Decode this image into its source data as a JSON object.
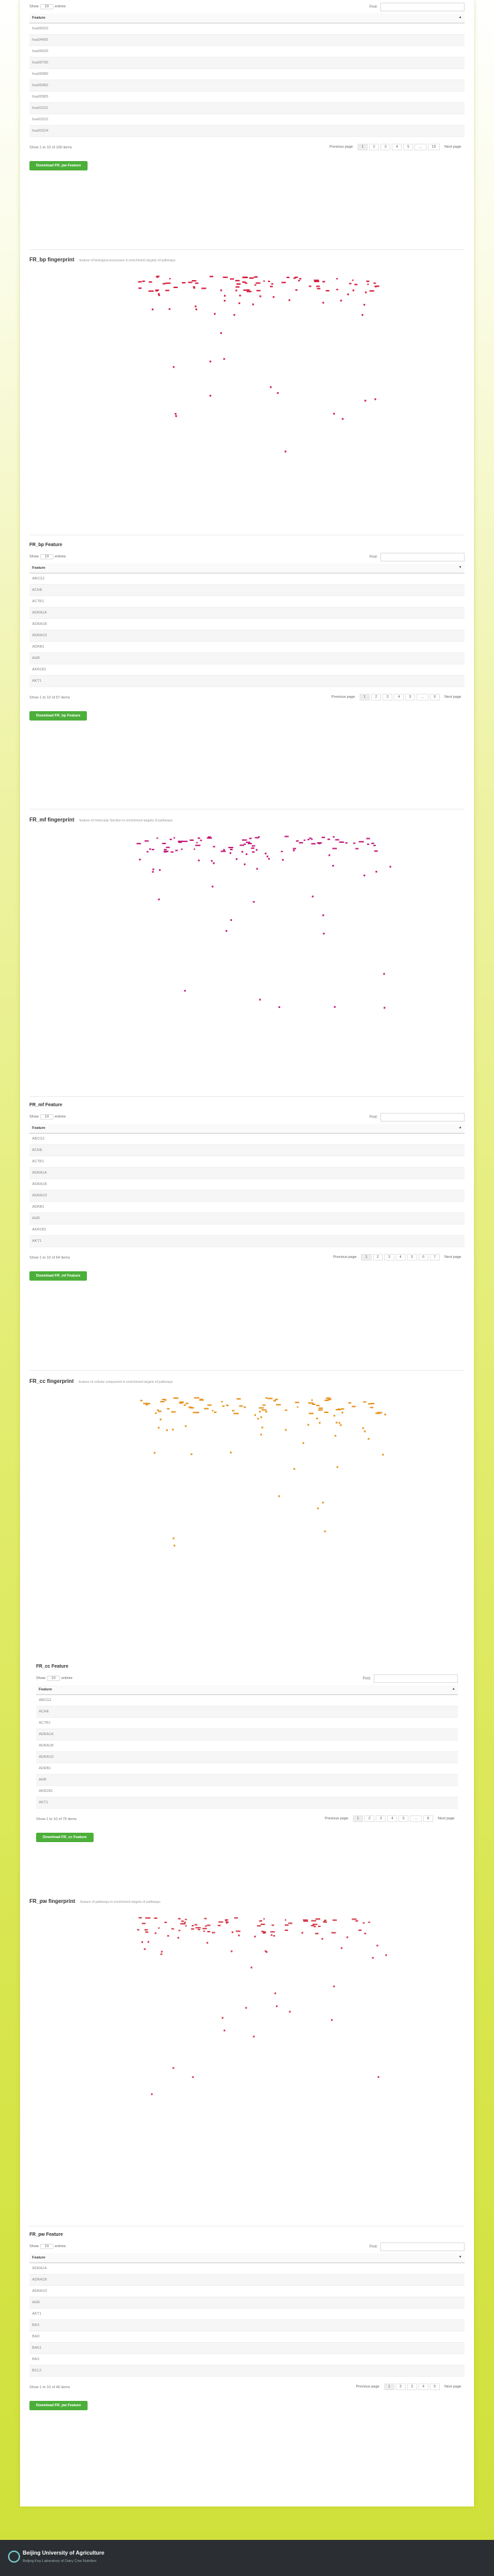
{
  "common": {
    "show_label": "Show",
    "entries_label": "entries",
    "page_size": "10",
    "find_label": "Find:",
    "feature_header": "Feature",
    "prev": "Previous page",
    "next": "Next page",
    "ellipsis": "…"
  },
  "tables": [
    {
      "title": "",
      "rows": [
        "hsa00910",
        "hsa04666",
        "hsa00020",
        "hsa00790",
        "hsa00980",
        "hsa00982",
        "hsa00983",
        "hsa01521",
        "hsa01522",
        "hsa01524"
      ],
      "info": "Show 1 to 10 of 190 items",
      "pages": [
        "1",
        "2",
        "3",
        "4",
        "5",
        "…",
        "19"
      ],
      "download": "Download FR_pw Feature"
    },
    {
      "title": "FR_bp Feature",
      "rows": [
        "ABCG2",
        "ACHE",
        "ACTB1",
        "ADRA1A",
        "ADRA1B",
        "ADRA1D",
        "ADRB1",
        "AHR",
        "AKR1B1",
        "AKT1"
      ],
      "info": "Show 1 to 10 of 57 items",
      "pages": [
        "1",
        "2",
        "3",
        "4",
        "5",
        "…",
        "6"
      ],
      "download": "Download FR_bp Feature"
    },
    {
      "title": "FR_mf Feature",
      "rows": [
        "ABCG2",
        "ACHE",
        "ACTB1",
        "ADRA1A",
        "ADRA1B",
        "ADRA1D",
        "ADRB1",
        "AHR",
        "AKR1B1",
        "AKT1"
      ],
      "info": "Show 1 to 10 of 64 items",
      "pages": [
        "1",
        "2",
        "3",
        "4",
        "5",
        "6",
        "7"
      ],
      "download": "Download FR_mf Feature"
    },
    {
      "title": "FR_cc Feature",
      "rows": [
        "ABCG2",
        "ACHE",
        "ACTB1",
        "ADRA1A",
        "ADRA1B",
        "ADRA1D",
        "ADRB1",
        "AHR",
        "AKR1B1",
        "AKT1"
      ],
      "info": "Show 1 to 10 of 75 items",
      "pages": [
        "1",
        "2",
        "3",
        "4",
        "5",
        "…",
        "8"
      ],
      "download": "Download FR_cc Feature"
    },
    {
      "title": "FR_pw Feature",
      "rows": [
        "ADRA1A",
        "ADRA1B",
        "ADRA1D",
        "AHR",
        "AKT1",
        "BAX",
        "BAD",
        "BAK1",
        "BAX",
        "BCL2"
      ],
      "info": "Show 1 to 10 of 46 items",
      "pages": [
        "1",
        "2",
        "3",
        "4",
        "5"
      ],
      "download": "Download FR_pw Feature"
    }
  ],
  "plots": [
    {
      "title": "FR_bp fingerprint",
      "subtitle": "feature of biological processes in enrichment targets of pathways",
      "color": "#d6183a"
    },
    {
      "title": "FR_mf fingerprint",
      "subtitle": "feature of molecular function in enrichment targets of pathways",
      "color": "#c2187a"
    },
    {
      "title": "FR_cc fingerprint",
      "subtitle": "feature of cellular component in enrichment targets of pathways",
      "color": "#e8901a"
    },
    {
      "title": "FR_pw fingerprint",
      "subtitle": "feature of pathways in enrichment targets of pathways",
      "color": "#d43a4a"
    }
  ],
  "footer": {
    "name": "Beijing University of Agriculture",
    "lab": "Beijing Key Laboratory of Dairy Cow Nutrition"
  }
}
